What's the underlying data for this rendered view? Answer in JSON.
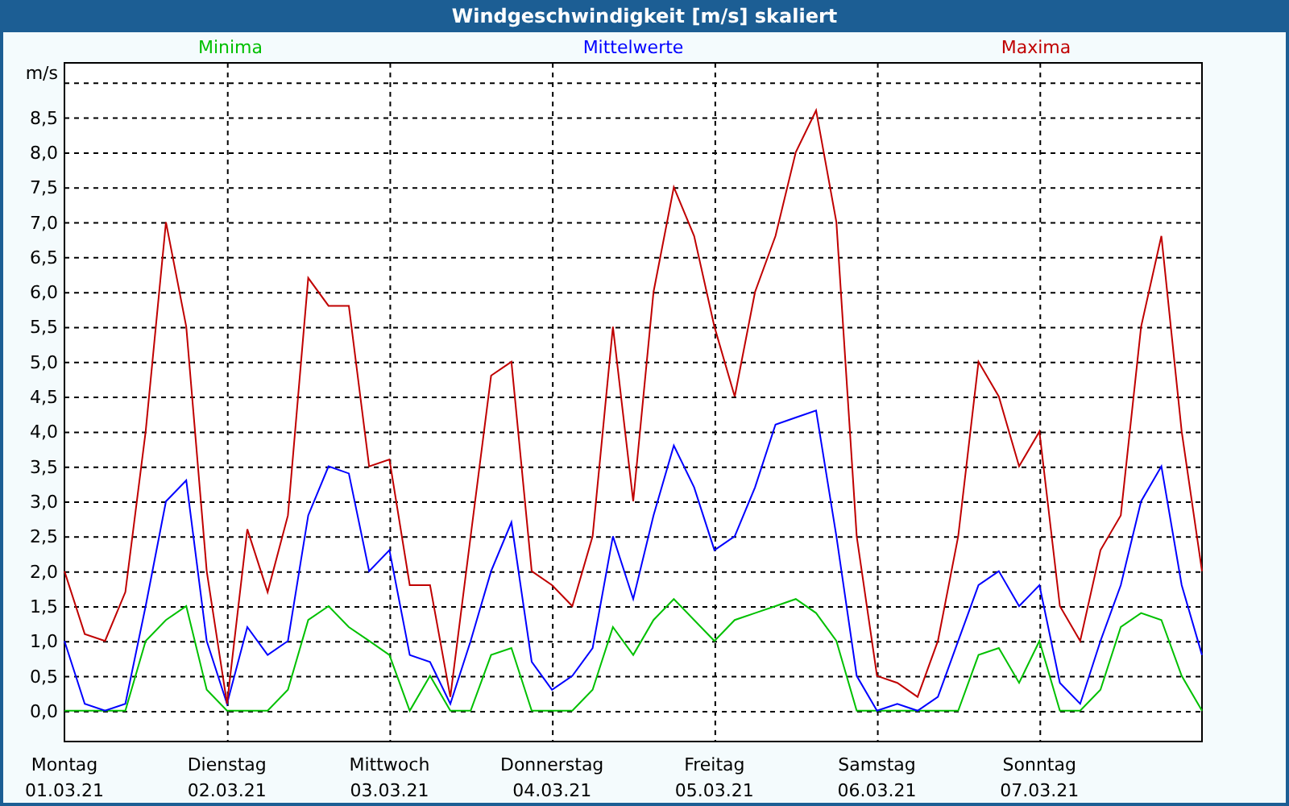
{
  "window": {
    "title": "Windgeschwindigkeit [m/s] skaliert"
  },
  "chart": {
    "chart_data": {
      "type": "line",
      "ylabel": "m/s",
      "categories": [
        "Montag 01.03.21",
        null,
        null,
        null,
        null,
        null,
        null,
        null,
        "Dienstag 02.03.21",
        null,
        null,
        null,
        null,
        null,
        null,
        null,
        "Mittwoch 03.03.21",
        null,
        null,
        null,
        null,
        null,
        null,
        null,
        "Donnerstag 04.03.21",
        null,
        null,
        null,
        null,
        null,
        null,
        null,
        "Freitag 05.03.21",
        null,
        null,
        null,
        null,
        null,
        null,
        null,
        "Samstag 06.03.21",
        null,
        null,
        null,
        null,
        null,
        null,
        null,
        "Sonntag 07.03.21",
        null,
        null,
        null,
        null,
        null,
        null,
        null,
        null
      ],
      "series": [
        {
          "name": "Minima",
          "color": "#00c000",
          "values": [
            0,
            0,
            0,
            0,
            1.0,
            1.3,
            1.5,
            0.3,
            0,
            0,
            0,
            0.3,
            1.3,
            1.5,
            1.2,
            1.0,
            0.8,
            0,
            0.5,
            0,
            0,
            0.8,
            0.9,
            0,
            0,
            0,
            0.3,
            1.2,
            0.8,
            1.3,
            1.6,
            1.3,
            1.0,
            1.3,
            1.4,
            1.5,
            1.6,
            1.4,
            1.0,
            0,
            0,
            0,
            0,
            0,
            0,
            0.8,
            0.9,
            0.4,
            1.0,
            0,
            0,
            0.3,
            1.2,
            1.4,
            1.3,
            0.5,
            0
          ]
        },
        {
          "name": "Mittelwerte",
          "color": "#0000ff",
          "values": [
            1.0,
            0.1,
            0,
            0.1,
            1.5,
            3.0,
            3.3,
            1.0,
            0.1,
            1.2,
            0.8,
            1.0,
            2.8,
            3.5,
            3.4,
            2.0,
            2.3,
            0.8,
            0.7,
            0.1,
            1.0,
            2.0,
            2.7,
            0.7,
            0.3,
            0.5,
            0.9,
            2.5,
            1.6,
            2.8,
            3.8,
            3.2,
            2.3,
            2.5,
            3.2,
            4.1,
            4.2,
            4.3,
            2.5,
            0.5,
            0,
            0.1,
            0,
            0.2,
            1.0,
            1.8,
            2.0,
            1.5,
            1.8,
            0.4,
            0.1,
            1.0,
            1.8,
            3.0,
            3.5,
            1.8,
            0.8
          ]
        },
        {
          "name": "Maxima",
          "color": "#c00000",
          "values": [
            2.0,
            1.1,
            1.0,
            1.7,
            4.0,
            7.0,
            5.5,
            2.0,
            0.1,
            2.6,
            1.7,
            2.8,
            6.2,
            5.8,
            5.8,
            3.5,
            3.6,
            1.8,
            1.8,
            0.2,
            2.5,
            4.8,
            5.0,
            2.0,
            1.8,
            1.5,
            2.5,
            5.5,
            3.0,
            6.0,
            7.5,
            6.8,
            5.5,
            4.5,
            6.0,
            6.8,
            8.0,
            8.6,
            7.0,
            2.5,
            0.5,
            0.4,
            0.2,
            1.0,
            2.5,
            5.0,
            4.5,
            3.5,
            4.0,
            1.5,
            1.0,
            2.3,
            2.8,
            5.5,
            6.8,
            4.0,
            2.0
          ]
        }
      ],
      "ylim": [
        -0.44,
        9.28
      ],
      "grid": true,
      "yticks": [
        {
          "value": 0,
          "label": "0,0"
        },
        {
          "value": 0.5,
          "label": "0,5"
        },
        {
          "value": 1,
          "label": "1,0"
        },
        {
          "value": 1.5,
          "label": "1,5"
        },
        {
          "value": 2,
          "label": "2,0"
        },
        {
          "value": 2.5,
          "label": "2,5"
        },
        {
          "value": 3,
          "label": "3,0"
        },
        {
          "value": 3.5,
          "label": "3,5"
        },
        {
          "value": 4,
          "label": "4,0"
        },
        {
          "value": 4.5,
          "label": "4,5"
        },
        {
          "value": 5,
          "label": "5,0"
        },
        {
          "value": 5.5,
          "label": "5,5"
        },
        {
          "value": 6,
          "label": "6,0"
        },
        {
          "value": 6.5,
          "label": "6,5"
        },
        {
          "value": 7,
          "label": "7,0"
        },
        {
          "value": 7.5,
          "label": "7,5"
        },
        {
          "value": 8,
          "label": "8,0"
        },
        {
          "value": 8.5,
          "label": "8,5"
        }
      ]
    }
  }
}
